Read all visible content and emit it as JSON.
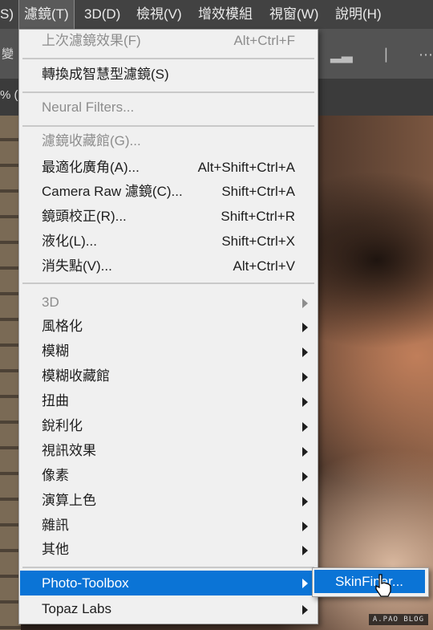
{
  "menubar": {
    "items": [
      {
        "label": "S)"
      },
      {
        "label": "濾鏡(T)"
      },
      {
        "label": "3D(D)"
      },
      {
        "label": "檢視(V)"
      },
      {
        "label": "增效模組"
      },
      {
        "label": "視窗(W)"
      },
      {
        "label": "說明(H)"
      }
    ]
  },
  "options_bar": {
    "label": "變"
  },
  "tab_bar": {
    "label": "% ("
  },
  "filter_menu": {
    "items": [
      {
        "label": "上次濾鏡效果(F)",
        "shortcut": "Alt+Ctrl+F",
        "disabled": true
      },
      {
        "label": "轉換成智慧型濾鏡(S)",
        "shortcut": ""
      },
      {
        "label": "Neural Filters...",
        "shortcut": "",
        "disabled": true
      },
      {
        "label": "濾鏡收藏館(G)...",
        "shortcut": "",
        "disabled": true
      },
      {
        "label": "最適化廣角(A)...",
        "shortcut": "Alt+Shift+Ctrl+A"
      },
      {
        "label": "Camera Raw 濾鏡(C)...",
        "shortcut": "Shift+Ctrl+A"
      },
      {
        "label": "鏡頭校正(R)...",
        "shortcut": "Shift+Ctrl+R"
      },
      {
        "label": "液化(L)...",
        "shortcut": "Shift+Ctrl+X"
      },
      {
        "label": "消失點(V)...",
        "shortcut": "Alt+Ctrl+V"
      },
      {
        "label": "3D",
        "submenu": true,
        "disabled": true
      },
      {
        "label": "風格化",
        "submenu": true
      },
      {
        "label": "模糊",
        "submenu": true
      },
      {
        "label": "模糊收藏館",
        "submenu": true
      },
      {
        "label": "扭曲",
        "submenu": true
      },
      {
        "label": "銳利化",
        "submenu": true
      },
      {
        "label": "視訊效果",
        "submenu": true
      },
      {
        "label": "像素",
        "submenu": true
      },
      {
        "label": "演算上色",
        "submenu": true
      },
      {
        "label": "雜訊",
        "submenu": true
      },
      {
        "label": "其他",
        "submenu": true
      },
      {
        "label": "Photo-Toolbox",
        "submenu": true,
        "selected": true
      },
      {
        "label": "Topaz Labs",
        "submenu": true
      }
    ]
  },
  "submenu": {
    "item_label": "SkinFiner..."
  },
  "watermark": {
    "text": "A.PAO BLOG"
  },
  "colors": {
    "highlight": "#0b74d6",
    "menu_bg": "#f0f0f0",
    "menubar_bg": "#424242"
  }
}
